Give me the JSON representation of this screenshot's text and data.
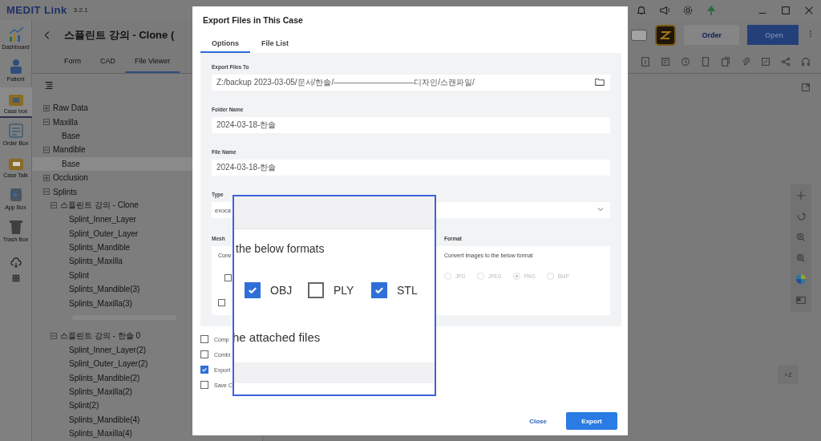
{
  "app": {
    "name": "MEDIT Link",
    "version": "3.2.1"
  },
  "nav": [
    {
      "label": "Dashboard",
      "selected": false
    },
    {
      "label": "Patient",
      "selected": false
    },
    {
      "label": "Case box",
      "selected": true
    },
    {
      "label": "Order Box",
      "selected": false
    },
    {
      "label": "Case Talk",
      "selected": false
    },
    {
      "label": "App Box",
      "selected": false
    },
    {
      "label": "Trash Box",
      "selected": false
    }
  ],
  "case_title": "스플린트 강의 - Clone (",
  "header_buttons": [
    {
      "label": "Order",
      "kind": "secondary"
    },
    {
      "label": "Open",
      "kind": "primary"
    }
  ],
  "tabs": [
    {
      "label": "Form",
      "selected": false
    },
    {
      "label": "CAD",
      "selected": false
    },
    {
      "label": "File Viewer",
      "selected": true
    }
  ],
  "tree": [
    {
      "label": "Raw Data",
      "expanded": false,
      "selected": false
    },
    {
      "label": "Maxilla",
      "expanded": true,
      "selected": false,
      "children": [
        {
          "label": "Base",
          "selected": false
        }
      ]
    },
    {
      "label": "Mandible",
      "expanded": true,
      "selected": false,
      "children": [
        {
          "label": "Base",
          "selected": true
        }
      ]
    },
    {
      "label": "Occlusion",
      "expanded": false,
      "selected": false
    },
    {
      "label": "Splints",
      "expanded": true,
      "selected": false,
      "children": [
        {
          "label": "스플린트 강의 - Clone",
          "expanded": true,
          "selected": false,
          "children": [
            {
              "label": "Splint_Inner_Layer",
              "selected": false
            },
            {
              "label": "Splint_Outer_Layer",
              "selected": false
            },
            {
              "label": "Splints_Mandible",
              "selected": false
            },
            {
              "label": "Splints_Maxilla",
              "selected": false
            },
            {
              "label": "Splint",
              "selected": false
            },
            {
              "label": "Splints_Mandible(3)",
              "selected": false
            },
            {
              "label": "Splints_Maxilla(3)",
              "selected": false
            },
            {
              "kind": "blurred"
            }
          ]
        },
        {
          "label": "스플린트 강의 - 한솔 0",
          "expanded": true,
          "selected": false,
          "children": [
            {
              "label": "Splint_Inner_Layer(2)",
              "selected": false
            },
            {
              "label": "Splint_Outer_Layer(2)",
              "selected": false
            },
            {
              "label": "Splints_Mandible(2)",
              "selected": false
            },
            {
              "label": "Splints_Maxilla(2)",
              "selected": false
            },
            {
              "label": "Splint(2)",
              "selected": false
            },
            {
              "label": "Splints_Mandible(4)",
              "selected": false
            },
            {
              "label": "Splints_Maxilla(4)",
              "selected": false
            }
          ]
        }
      ]
    }
  ],
  "viewer": {
    "zoom_button": "+Z"
  },
  "dialog": {
    "title": "Export Files in This Case",
    "tabs": [
      {
        "label": "Options",
        "selected": true
      },
      {
        "label": "File List",
        "selected": false
      }
    ],
    "export_to": {
      "label": "Export Files To",
      "value": "Z:/backup 2023-03-05/문서/한솔/——————————디자인/스캔파일/"
    },
    "folder_name": {
      "label": "Folder Name",
      "value": "2024-03-18-한솔"
    },
    "file_name": {
      "label": "File Name",
      "value": "2024-03-18-한솔"
    },
    "type": {
      "label": "Type",
      "value": "exoca"
    },
    "mesh": {
      "label": "Mesh",
      "text": "Conv",
      "options": [
        {
          "checked": false
        },
        {
          "checked": false
        }
      ]
    },
    "image": {
      "label": "Format",
      "text": "Convert images to the below format",
      "formats": [
        {
          "label": "JPG",
          "selected": false
        },
        {
          "label": "JPEG",
          "selected": false
        },
        {
          "label": "PNG",
          "selected": true
        },
        {
          "label": "BMP",
          "selected": false
        }
      ]
    },
    "options": [
      {
        "label": "Comp",
        "checked": false
      },
      {
        "label": "Combi",
        "checked": false
      },
      {
        "label": "Export",
        "checked": true
      },
      {
        "label": "Save C",
        "checked": false
      }
    ],
    "buttons": [
      {
        "label": "Close",
        "kind": "text"
      },
      {
        "label": "Export",
        "kind": "primary"
      }
    ]
  },
  "magnifier": {
    "heading": "the below formats",
    "formats": [
      {
        "label": "OBJ",
        "checked": true
      },
      {
        "label": "PLY",
        "checked": false
      },
      {
        "label": "STL",
        "checked": true
      }
    ],
    "footer": "he attached files"
  }
}
